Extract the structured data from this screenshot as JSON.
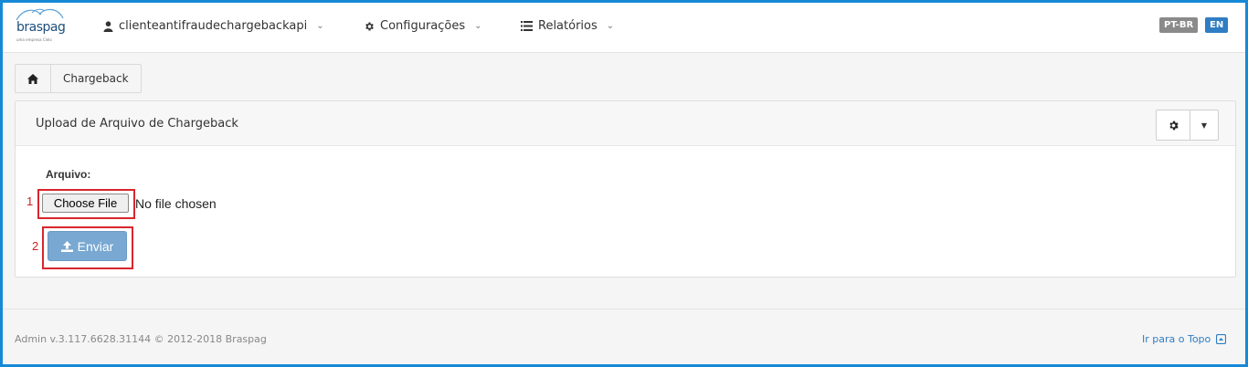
{
  "navbar": {
    "logo_text": "braspag",
    "logo_sub": "uma empresa Cielo",
    "user_label": "clienteantifraudechargebackapi",
    "config_label": "Configurações",
    "reports_label": "Relatórios",
    "lang_pt": "PT-BR",
    "lang_en": "EN"
  },
  "breadcrumb": {
    "home_icon": "home-icon",
    "current": "Chargeback"
  },
  "panel": {
    "title": "Upload de Arquivo de Chargeback",
    "settings_icon": "gear-icon",
    "field_label": "Arquivo:",
    "choose_file_label": "Choose File",
    "no_file_text": "No file chosen",
    "submit_label": "Enviar",
    "step1": "1",
    "step2": "2"
  },
  "footer": {
    "copyright": "Admin v.3.117.6628.31144 © 2012-2018 Braspag",
    "top_link": "Ir para o Topo"
  },
  "colors": {
    "frame_border": "#1589d6",
    "primary": "#2f7dc3",
    "highlight": "#d8262e"
  }
}
